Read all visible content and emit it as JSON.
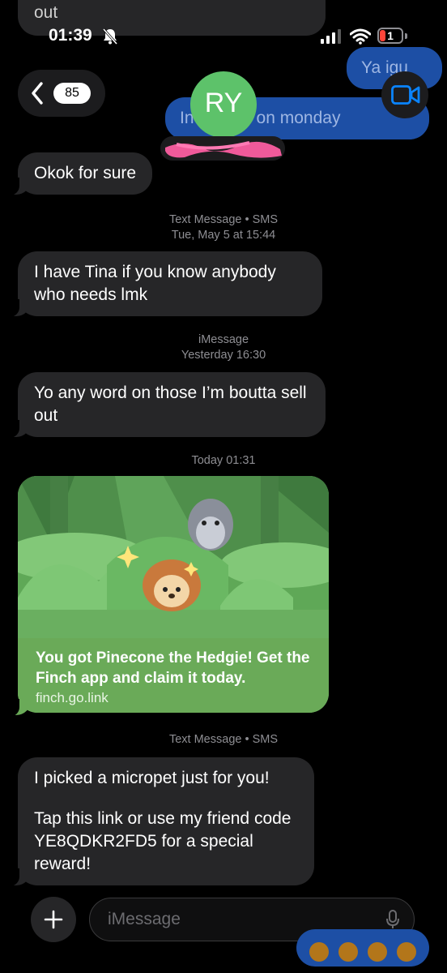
{
  "status_bar": {
    "time": "01:39",
    "battery": "1"
  },
  "header": {
    "back_count": "85",
    "contact_initials": "RY"
  },
  "bg_bubbles": {
    "top_left_text": "out",
    "top_right_text": "Ya igu",
    "under_header_text": "In   g more on monday"
  },
  "messages": [
    {
      "text": "Okok for sure"
    },
    {
      "meta_line1": "Text Message • SMS",
      "meta_line2": "Tue, May 5 at 15:44"
    },
    {
      "text": "I have Tina if you know anybody who needs lmk"
    },
    {
      "meta_line1": "iMessage",
      "meta_line2": "Yesterday 16:30"
    },
    {
      "text": "Yo any word on those I’m boutta sell out"
    },
    {
      "meta_line1": "Today 01:31"
    },
    {
      "rich_title": "You got Pinecone the Hedgie! Get the Finch app and claim it today.",
      "rich_link": "finch.go.link"
    },
    {
      "meta_line1": "Text Message • SMS"
    },
    {
      "text_line1": "I picked a micropet just for you!",
      "text_line2": "Tap this link or use my friend code YE8QDKR2FD5 for a special reward!"
    }
  ],
  "composer": {
    "placeholder": "iMessage",
    "faint_label": "iMessage"
  },
  "colors": {
    "incoming": "#262628",
    "outgoing": "#1d4fa5",
    "avatar": "#5dc26a",
    "rich_caption": "#6aaa58"
  }
}
